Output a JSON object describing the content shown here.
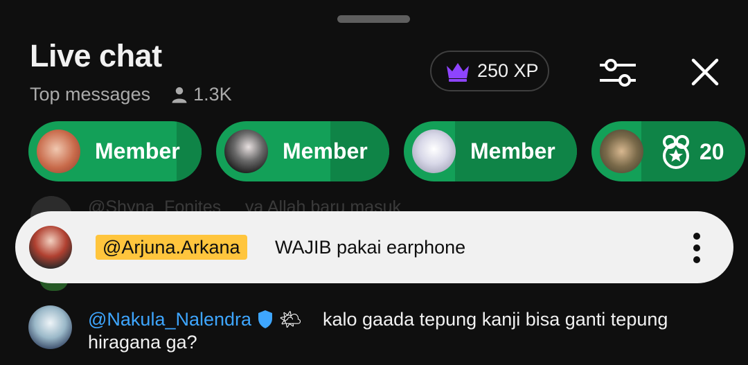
{
  "header": {
    "title": "Live chat",
    "mode_label": "Top messages",
    "viewer_count": "1.3K",
    "xp_label": "250 XP"
  },
  "icons": {
    "viewers": "person-icon",
    "xp": "crown-icon",
    "filter": "sliders-icon",
    "close": "close-icon",
    "gift": "gift-icon",
    "more": "more-vertical-icon",
    "verified": "verified-shield-icon",
    "emoji": "sun-behind-cloud-icon"
  },
  "chips": [
    {
      "label": "Member"
    },
    {
      "label": "Member"
    },
    {
      "label": "Member"
    },
    {
      "label": "20"
    }
  ],
  "background_message": {
    "author": "@Shyna_Fonites",
    "text": "ya Allah baru masuk"
  },
  "pinned": {
    "author": "@Arjuna.Arkana",
    "text": "WAJIB pakai earphone"
  },
  "message": {
    "author": "@Nakula_Nalendra",
    "emoji": "🌤",
    "text_line1": "kalo gaada tepung kanji bisa ganti tepung",
    "text_line2": "hiragana ga?"
  },
  "colors": {
    "background": "#0f0f0f",
    "chip_green": "#13a058",
    "chip_green_dark": "#0f8447",
    "author_highlight": "#ffc53d",
    "link_blue": "#3ea6ff",
    "crown_purple": "#8e44ff",
    "pinned_bg": "#f1f1f1"
  }
}
